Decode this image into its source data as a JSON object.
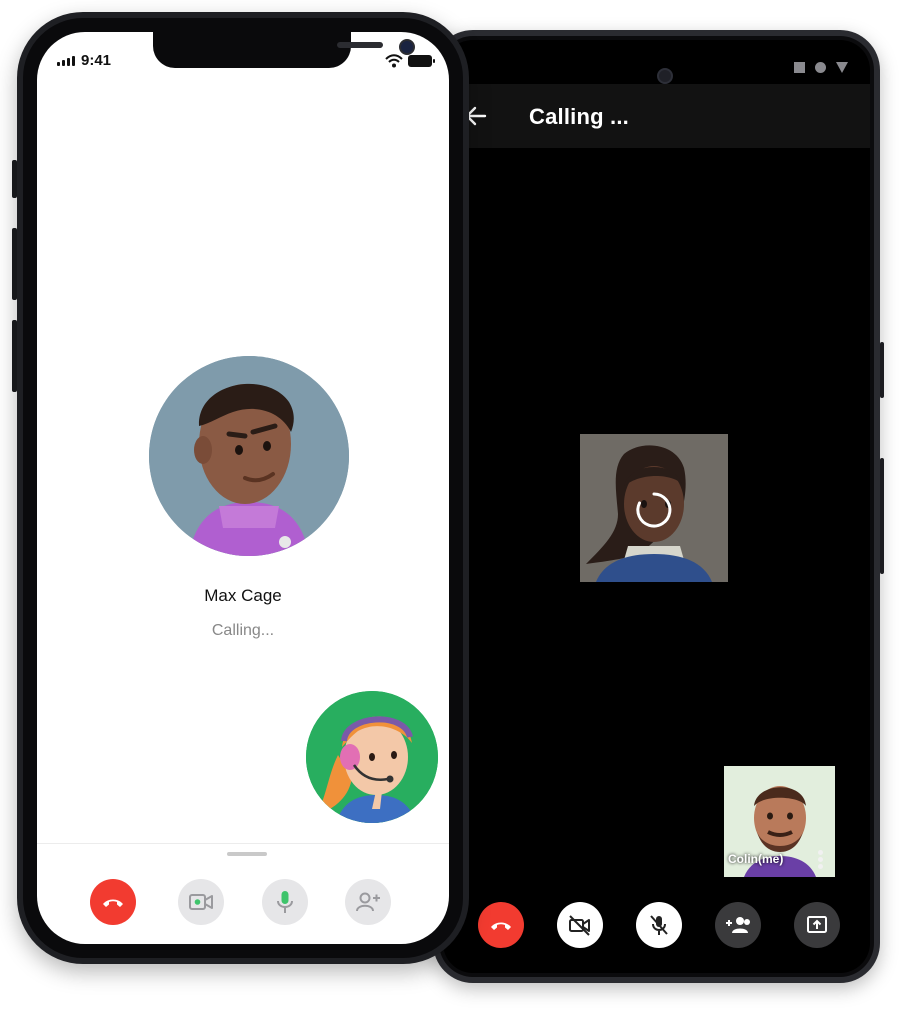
{
  "android": {
    "appbar": {
      "title": "Calling ..."
    },
    "self_tile": {
      "label": "Colin(me)"
    },
    "controls": [
      {
        "name": "end-call",
        "icon": "phone-hangup-icon",
        "color": "#f23b30"
      },
      {
        "name": "video-off",
        "icon": "video-off-icon",
        "color": "#ffffff"
      },
      {
        "name": "mic-off",
        "icon": "mic-off-icon",
        "color": "#ffffff"
      },
      {
        "name": "add-participant",
        "icon": "group-add-icon",
        "color": "#3a3a3c"
      },
      {
        "name": "share-screen",
        "icon": "screen-share-icon",
        "color": "#3a3a3c"
      }
    ]
  },
  "iphone": {
    "status": {
      "time": "9:41"
    },
    "callee": {
      "name": "Max Cage",
      "status": "Calling..."
    },
    "controls": [
      {
        "name": "end-call",
        "icon": "phone-hangup-icon",
        "color": "#f23b30"
      },
      {
        "name": "video",
        "icon": "video-icon",
        "color": "#e6e6e8"
      },
      {
        "name": "mic",
        "icon": "mic-icon",
        "color": "#e6e6e8"
      },
      {
        "name": "add-person",
        "icon": "person-add-icon",
        "color": "#e6e6e8"
      }
    ]
  }
}
